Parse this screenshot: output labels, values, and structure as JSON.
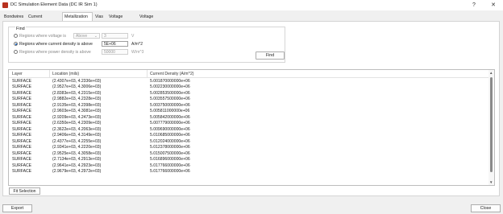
{
  "window": {
    "title": "DC Simulation Element Data (DC IR Sim 1)"
  },
  "tabs": [
    {
      "label": "Bondwires",
      "active": false
    },
    {
      "label": "Current Sources",
      "active": false
    },
    {
      "label": "Metallization",
      "active": true
    },
    {
      "label": "Vias",
      "active": false
    },
    {
      "label": "Voltage Probes",
      "active": false
    },
    {
      "label": "Voltage Sources",
      "active": false
    }
  ],
  "find": {
    "group_label": "Find",
    "options": [
      {
        "label": "Regions where voltage is",
        "selected": false,
        "dropdown": "Above",
        "value": "3",
        "unit": "V"
      },
      {
        "label": "Regions where current density is above",
        "selected": true,
        "value": "5E+06",
        "unit": "A/m^2"
      },
      {
        "label": "Regions where power density is above",
        "selected": false,
        "value": "50000",
        "unit": "W/m^3"
      }
    ],
    "button": "Find"
  },
  "table": {
    "columns": [
      "Layer",
      "Location (mils)",
      "Current Density (A/m^2)"
    ],
    "rows": [
      [
        "SURFACE",
        "(2.4307e+03, 4.2336e+03)",
        "5.001870000000e+06"
      ],
      [
        "SURFACE",
        "(2.9527e+03, 4.3006e+03)",
        "5.002230000000e+06"
      ],
      [
        "SURFACE",
        "(2.8383e+03, 4.2315e+03)",
        "5.002853500000e+06"
      ],
      [
        "SURFACE",
        "(2.9882e+03, 4.2328e+03)",
        "5.003557500000e+06"
      ],
      [
        "SURFACE",
        "(2.9135e+03, 4.2398e+03)",
        "5.003750000000e+06"
      ],
      [
        "SURFACE",
        "(2.9603e+03, 4.3081e+03)",
        "5.005811000000e+06"
      ],
      [
        "SURFACE",
        "(2.9209e+03, 4.2473e+03)",
        "5.005842000000e+06"
      ],
      [
        "SURFACE",
        "(2.6350e+03, 4.2309e+03)",
        "5.007779000000e+06"
      ],
      [
        "SURFACE",
        "(2.3622e+03, 4.2063e+03)",
        "5.009690000000e+06"
      ],
      [
        "SURFACE",
        "(2.9406e+03, 4.3149e+03)",
        "5.010685000000e+06"
      ],
      [
        "SURFACE",
        "(2.4377e+03, 4.2255e+03)",
        "5.012024000000e+06"
      ],
      [
        "SURFACE",
        "(2.9341e+03, 4.2220e+03)",
        "5.012378000000e+06"
      ],
      [
        "SURFACE",
        "(2.9525e+03, 4.3058e+03)",
        "5.015007500000e+06"
      ],
      [
        "SURFACE",
        "(2.7134e+03, 4.2913e+03)",
        "5.016896000000e+06"
      ],
      [
        "SURFACE",
        "(2.9641e+03, 4.2923e+03)",
        "5.017766000000e+06"
      ],
      [
        "SURFACE",
        "(2.9679e+03, 4.2972e+03)",
        "5.017766000000e+06"
      ]
    ]
  },
  "buttons": {
    "fit_selection": "Fit Selection",
    "export": "Export",
    "close": "Close"
  }
}
